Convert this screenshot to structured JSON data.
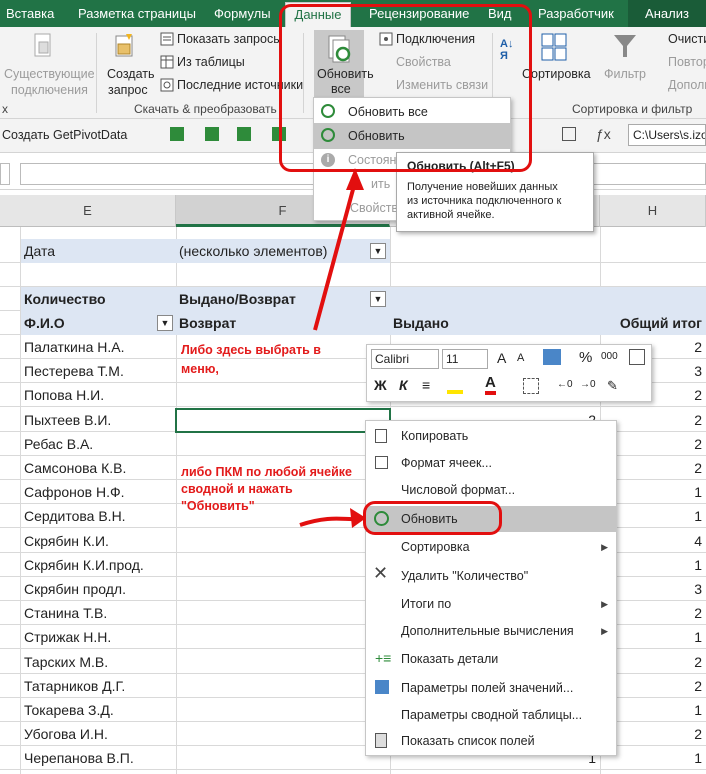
{
  "tabs": [
    "Вставка",
    "Разметка страницы",
    "Формулы",
    "Данные",
    "Рецензирование",
    "Вид",
    "Разработчик",
    "Анализ"
  ],
  "ribbon": {
    "existing_connections": [
      "Существующие",
      "подключения"
    ],
    "create_query": [
      "Создать",
      "запрос"
    ],
    "show_queries": "Показать запросы",
    "from_table": "Из таблицы",
    "recent_sources": "Последние источники",
    "group_get_transform": "Скачать & преобразовать",
    "refresh_all": [
      "Обновить",
      "все"
    ],
    "connections": "Подключения",
    "properties": "Свойства",
    "edit_links": "Изменить связи",
    "sort": "Сортировка",
    "filter": "Фильтр",
    "clear": "Очисти",
    "reapply": "Повтор",
    "advanced": "Дополн",
    "group_sort_filter": "Сортировка и фильтр",
    "group_left": "х"
  },
  "refresh_menu": {
    "refresh_all": "Обновить все",
    "refresh": "Обновить",
    "status": "Состоян",
    "cancel": "ить",
    "props": "Свойства"
  },
  "tooltip": {
    "title": "Обновить (Alt+F5)",
    "body": [
      "Получение новейших данных",
      "из источника подключенного к",
      "активной ячейке."
    ]
  },
  "toolbar": {
    "getpivot": "Создать GetPivotData",
    "path": "C:\\Users\\s.izot"
  },
  "columns": [
    "E",
    "F",
    "G",
    "H"
  ],
  "pivot": {
    "filter_label": "Дата",
    "filter_value": "(несколько элементов)",
    "count_label": "Количество",
    "vydano_vozvrat": "Выдано/Возврат",
    "fio": "Ф.И.О",
    "vozvrat": "Возврат",
    "vydano": "Выдано",
    "total": "Общий итог",
    "rows": [
      {
        "name": "Палаткина Н.А.",
        "vydano": "",
        "total": "2"
      },
      {
        "name": "Пестерева Т.М.",
        "vydano": "",
        "total": "3"
      },
      {
        "name": "Попова Н.И.",
        "vydano": "",
        "total": "2"
      },
      {
        "name": "Пыхтеев В.И.",
        "vydano": "2",
        "total": "2"
      },
      {
        "name": "Ребас В.А.",
        "vydano": "",
        "total": "2"
      },
      {
        "name": "Самсонова К.В.",
        "vydano": "",
        "total": "2"
      },
      {
        "name": "Сафронов Н.Ф.",
        "vydano": "",
        "total": "1"
      },
      {
        "name": "Сердитова В.Н.",
        "vydano": "",
        "total": "1"
      },
      {
        "name": "Скрябин К.И.",
        "vydano": "",
        "total": "4"
      },
      {
        "name": "Скрябин К.И.прод.",
        "vydano": "",
        "total": "1"
      },
      {
        "name": "Скрябин продл.",
        "vydano": "",
        "total": "3"
      },
      {
        "name": "Станина Т.В.",
        "vydano": "",
        "total": "2"
      },
      {
        "name": "Стрижак Н.Н.",
        "vydano": "",
        "total": "1"
      },
      {
        "name": "Тарских М.В.",
        "vydano": "",
        "total": "2"
      },
      {
        "name": "Татарников Д.Г.",
        "vydano": "",
        "total": "2"
      },
      {
        "name": "Токарева З.Д.",
        "vydano": "",
        "total": "1"
      },
      {
        "name": "Убогова И.Н.",
        "vydano": "",
        "total": "2"
      },
      {
        "name": "Черепанова В.П.",
        "vydano": "1",
        "total": "1"
      }
    ]
  },
  "annotations": {
    "note1": [
      "Либо здесь выбрать в",
      "меню,"
    ],
    "note2": [
      "либо ПКМ по любой ячейке",
      "сводной и нажать",
      "\"Обновить\""
    ]
  },
  "mini_toolbar": {
    "font": "Calibri",
    "size": "11"
  },
  "context_menu": [
    "Копировать",
    "Формат ячеек...",
    "Числовой формат...",
    "Обновить",
    "Сортировка",
    "Удалить \"Количество\"",
    "Итоги по",
    "Дополнительные вычисления",
    "Показать детали",
    "Параметры полей значений...",
    "Параметры сводной таблицы...",
    "Показать список полей"
  ],
  "colors": {
    "excel_green": "#217346",
    "highlight_red": "#e20f0f",
    "pivot_header": "#dde6f3"
  }
}
